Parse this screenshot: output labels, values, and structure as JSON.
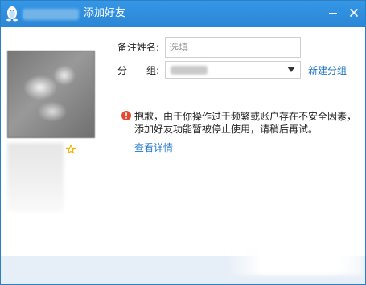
{
  "window": {
    "title": "添加好友",
    "icons": {
      "logo": "qq-penguin-icon",
      "minimize": "minimize-icon",
      "close": "close-icon"
    }
  },
  "profile": {
    "avatar": "avatar",
    "star_icon": "star-icon",
    "star_color": "#f0b400"
  },
  "form": {
    "remark_label": "备注姓名:",
    "remark_placeholder": "选填",
    "remark_value": "",
    "group_label_1": "分",
    "group_label_2": "组:",
    "group_dropdown_icon": "chevron-down-icon",
    "new_group_link": "新建分组"
  },
  "notice": {
    "icon": "error-icon",
    "icon_color": "#e24a2f",
    "message": "抱歉，由于你操作过于频繁或账户存在不安全因素，添加好友功能暂被停止使用，请稍后再试。",
    "details_link": "查看详情"
  },
  "colors": {
    "titlebar": "#2b86d6",
    "link": "#1e75c7",
    "footer": "#e6eef7"
  }
}
